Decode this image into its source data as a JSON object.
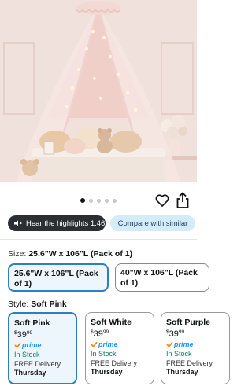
{
  "gallery": {
    "image_alt": "Pink canopy bed tent with fairy lights over a reading nook",
    "dot_count": 5,
    "active_dot": 0
  },
  "actions": {
    "favorite_icon": "heart-icon",
    "share_icon": "share-icon"
  },
  "highlights": {
    "label": "Hear the highlights 1:46",
    "icon": "audio-play-icon"
  },
  "compare": {
    "label": "Compare with similar"
  },
  "size": {
    "label": "Size:",
    "selected": "25.6\"W x 106\"L (Pack of 1)",
    "options": [
      {
        "label": "25.6\"W x 106\"L (Pack of 1)",
        "selected": true
      },
      {
        "label": "40\"W x 106\"L (Pack of 1)",
        "selected": false
      }
    ]
  },
  "style": {
    "label": "Style:",
    "selected": "Soft Pink",
    "options": [
      {
        "name": "Soft Pink",
        "price_dollar": "$",
        "price_whole": "39",
        "price_cents": "99",
        "prime": "prime",
        "stock": "In Stock",
        "delivery": "FREE Delivery",
        "day": "Thursday",
        "selected": true
      },
      {
        "name": "Soft White",
        "price_dollar": "$",
        "price_whole": "39",
        "price_cents": "99",
        "prime": "prime",
        "stock": "In Stock",
        "delivery": "FREE Delivery",
        "day": "Thursday",
        "selected": false
      },
      {
        "name": "Soft Purple",
        "price_dollar": "$",
        "price_whole": "39",
        "price_cents": "99",
        "prime": "prime",
        "stock": "In Stock",
        "delivery": "FREE Delivery",
        "day": "Thursday",
        "selected": false
      }
    ]
  },
  "colors": {
    "accent_blue": "#2f7ec2",
    "selected_bg": "#eef6fd",
    "stock_green": "#067d62",
    "prime_blue": "#1a98ff",
    "highlight_bg": "#2b2f33",
    "compare_bg": "#d5ebf8"
  }
}
